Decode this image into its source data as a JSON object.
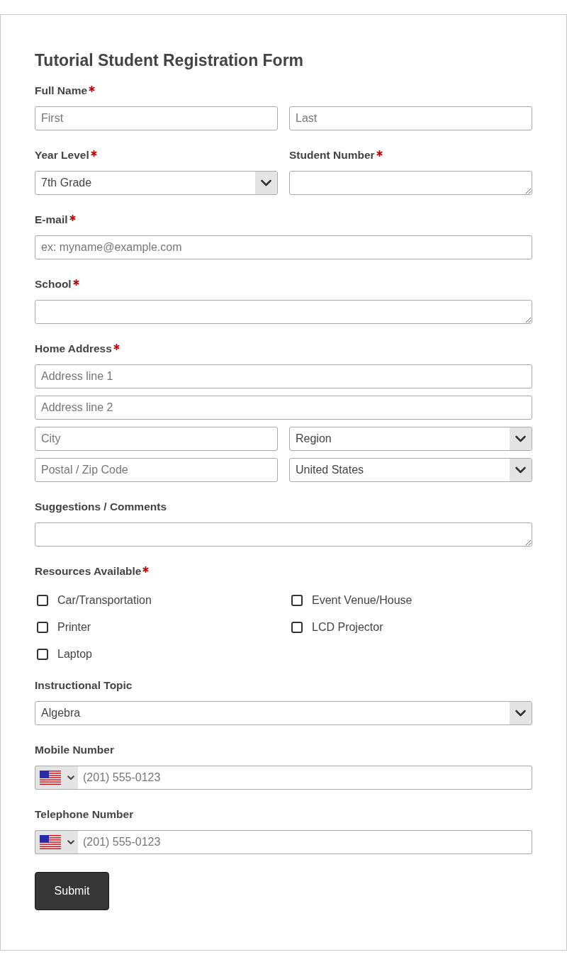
{
  "form": {
    "title": "Tutorial Student Registration Form",
    "fields": [
      {
        "kind": "input_group",
        "label": "Full Name",
        "required": true,
        "lines": [
          [
            {
              "kind": "text",
              "placeholder": "First"
            },
            {
              "kind": "text",
              "placeholder": "Last"
            }
          ]
        ]
      },
      {
        "kind": "split",
        "fields": [
          {
            "kind": "input_group",
            "label": "Year Level",
            "required": true,
            "lines": [
              [
                {
                  "kind": "select",
                  "value": "7th Grade"
                }
              ]
            ]
          },
          {
            "kind": "input_group",
            "label": "Student Number",
            "required": true,
            "lines": [
              [
                {
                  "kind": "textarea"
                }
              ]
            ]
          }
        ]
      },
      {
        "kind": "input_group",
        "label": "E-mail",
        "required": true,
        "lines": [
          [
            {
              "kind": "text",
              "placeholder": "ex: myname@example.com"
            }
          ]
        ]
      },
      {
        "kind": "input_group",
        "label": "School",
        "required": true,
        "lines": [
          [
            {
              "kind": "textarea"
            }
          ]
        ]
      },
      {
        "kind": "input_group",
        "label": "Home Address",
        "required": true,
        "lines": [
          [
            {
              "kind": "text",
              "placeholder": "Address line 1"
            }
          ],
          [
            {
              "kind": "text",
              "placeholder": "Address line 2"
            }
          ],
          [
            {
              "kind": "text",
              "placeholder": "City"
            },
            {
              "kind": "select",
              "value": "Region"
            }
          ],
          [
            {
              "kind": "text",
              "placeholder": "Postal / Zip Code"
            },
            {
              "kind": "select",
              "value": "United States"
            }
          ]
        ]
      },
      {
        "kind": "input_group",
        "label": "Suggestions / Comments",
        "required": false,
        "lines": [
          [
            {
              "kind": "textarea"
            }
          ]
        ]
      },
      {
        "kind": "checkbox_group",
        "label": "Resources Available",
        "required": true,
        "options": [
          {
            "label": "Car/Transportation",
            "checked": false
          },
          {
            "label": "Event Venue/House",
            "checked": false
          },
          {
            "label": "Printer",
            "checked": false
          },
          {
            "label": "LCD Projector",
            "checked": false
          },
          {
            "label": "Laptop",
            "checked": false
          }
        ]
      },
      {
        "kind": "input_group",
        "label": "Instructional Topic",
        "required": false,
        "lines": [
          [
            {
              "kind": "select",
              "value": "Algebra"
            }
          ]
        ]
      },
      {
        "kind": "input_group",
        "label": "Mobile Number",
        "required": false,
        "lines": [
          [
            {
              "kind": "phone",
              "placeholder": "(201) 555-0123"
            }
          ]
        ]
      },
      {
        "kind": "input_group",
        "label": "Telephone Number",
        "required": false,
        "lines": [
          [
            {
              "kind": "phone",
              "placeholder": "(201) 555-0123"
            }
          ]
        ]
      }
    ],
    "submit": {
      "label": "Submit"
    }
  }
}
